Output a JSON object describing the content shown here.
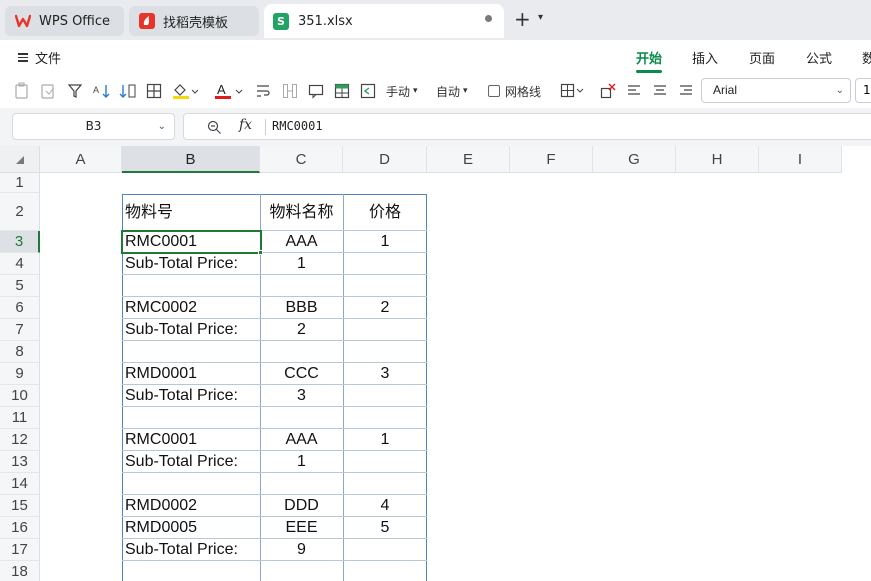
{
  "tabs": [
    {
      "label": "WPS Office",
      "icon": "wps-logo-icon"
    },
    {
      "label": "找稻壳模板",
      "icon": "docer-logo-icon"
    },
    {
      "label": "351.xlsx",
      "icon": "spreadsheet-s-icon",
      "badge": "S"
    }
  ],
  "menu": {
    "file_label": "文件",
    "ribbon_tabs": [
      "开始",
      "插入",
      "页面",
      "公式",
      "数"
    ],
    "active_tab": "开始"
  },
  "toolbar": {
    "row_height_label": "手动",
    "col_width_label": "自动",
    "gridlines_label": "网格线",
    "gridlines_checked": false,
    "font_name": "Arial",
    "font_size": "1"
  },
  "formula_bar": {
    "name_box": "B3",
    "fx_label": "fx",
    "content": "RMC0001"
  },
  "sheet": {
    "columns": [
      "A",
      "B",
      "C",
      "D",
      "E",
      "F",
      "G",
      "H",
      "I"
    ],
    "selected_column": "B",
    "rows": [
      "1",
      "2",
      "3",
      "4",
      "5",
      "6",
      "7",
      "8",
      "9",
      "10",
      "11",
      "12",
      "13",
      "14",
      "15",
      "16",
      "17",
      "18"
    ],
    "selected_row": "3",
    "header": {
      "b": "物料号",
      "c": "物料名称",
      "d": "价格"
    },
    "data": [
      {
        "row": "3",
        "b": "RMC0001",
        "c": "AAA",
        "d": "1"
      },
      {
        "row": "4",
        "b": "Sub-Total Price:",
        "c": "1",
        "d": ""
      },
      {
        "row": "5",
        "b": "",
        "c": "",
        "d": ""
      },
      {
        "row": "6",
        "b": "RMC0002",
        "c": "BBB",
        "d": "2"
      },
      {
        "row": "7",
        "b": "Sub-Total Price:",
        "c": "2",
        "d": ""
      },
      {
        "row": "8",
        "b": "",
        "c": "",
        "d": ""
      },
      {
        "row": "9",
        "b": "RMD0001",
        "c": "CCC",
        "d": "3"
      },
      {
        "row": "10",
        "b": "Sub-Total Price:",
        "c": "3",
        "d": ""
      },
      {
        "row": "11",
        "b": "",
        "c": "",
        "d": ""
      },
      {
        "row": "12",
        "b": "RMC0001",
        "c": "AAA",
        "d": "1"
      },
      {
        "row": "13",
        "b": "Sub-Total Price:",
        "c": "1",
        "d": ""
      },
      {
        "row": "14",
        "b": "",
        "c": "",
        "d": ""
      },
      {
        "row": "15",
        "b": "RMD0002",
        "c": "DDD",
        "d": "4"
      },
      {
        "row": "16",
        "b": "RMD0005",
        "c": "EEE",
        "d": "5"
      },
      {
        "row": "17",
        "b": "Sub-Total Price:",
        "c": "9",
        "d": ""
      },
      {
        "row": "18",
        "b": "",
        "c": "",
        "d": ""
      }
    ]
  },
  "colors": {
    "accent": "#0b8a4a",
    "selection": "#1e7b34",
    "table_border": "#4f86b8",
    "wps_red": "#e8352c"
  }
}
